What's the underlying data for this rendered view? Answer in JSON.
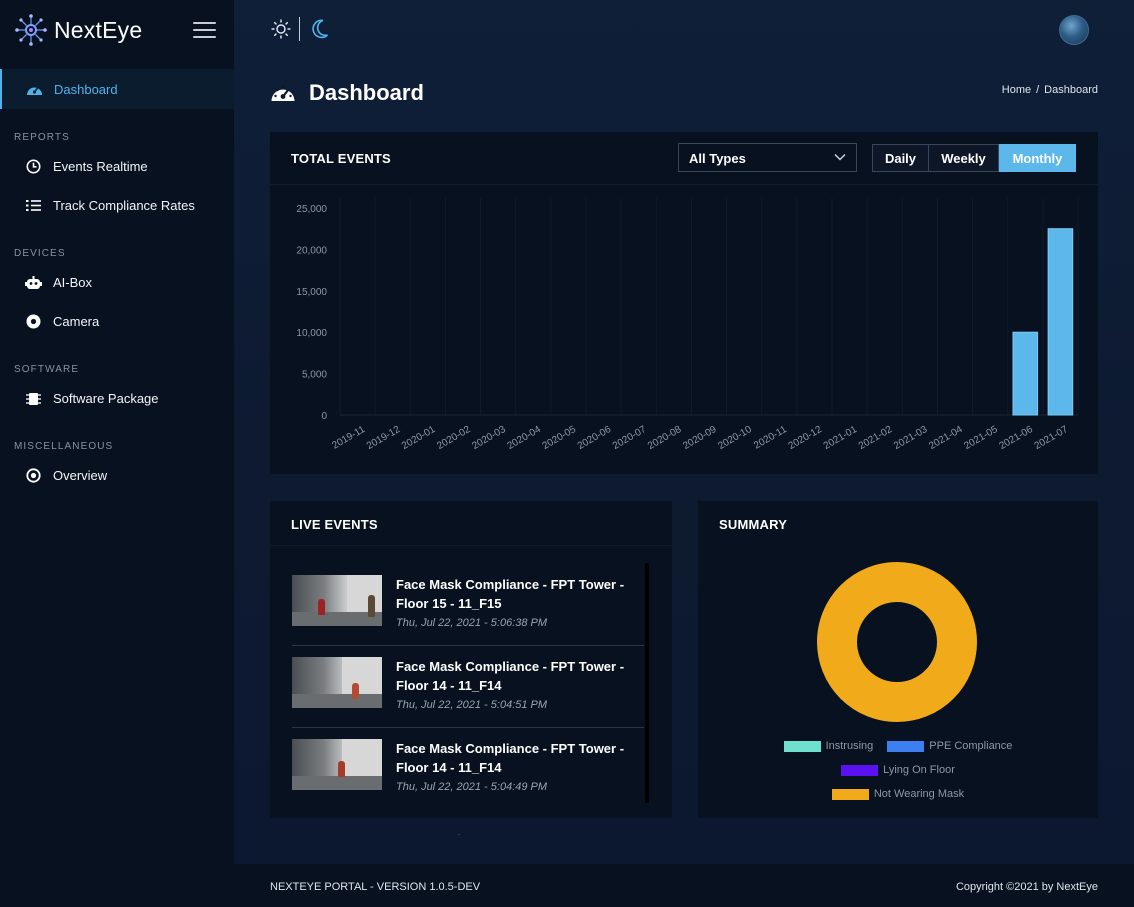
{
  "brand": {
    "name": "NextEye"
  },
  "sidebar": {
    "dashboard": "Dashboard",
    "sections": [
      {
        "title": "REPORTS",
        "items": [
          {
            "label": "Events Realtime",
            "icon": "clock-icon"
          },
          {
            "label": "Track Compliance Rates",
            "icon": "list-check-icon"
          }
        ]
      },
      {
        "title": "DEVICES",
        "items": [
          {
            "label": "AI-Box",
            "icon": "robot-icon"
          },
          {
            "label": "Camera",
            "icon": "camera-icon"
          }
        ]
      },
      {
        "title": "SOFTWARE",
        "items": [
          {
            "label": "Software Package",
            "icon": "chip-icon"
          }
        ]
      },
      {
        "title": "MISCELLANEOUS",
        "items": [
          {
            "label": "Overview",
            "icon": "target-icon"
          }
        ]
      }
    ]
  },
  "page": {
    "title": "Dashboard"
  },
  "breadcrumb": {
    "home": "Home",
    "sep": "/",
    "current": "Dashboard"
  },
  "total_events": {
    "title": "TOTAL EVENTS",
    "filter_value": "All Types",
    "periods": {
      "daily": "Daily",
      "weekly": "Weekly",
      "monthly": "Monthly"
    },
    "active_period": "Monthly"
  },
  "chart_data": {
    "type": "bar",
    "categories": [
      "2019-11",
      "2019-12",
      "2020-01",
      "2020-02",
      "2020-03",
      "2020-04",
      "2020-05",
      "2020-06",
      "2020-07",
      "2020-08",
      "2020-09",
      "2020-10",
      "2020-11",
      "2020-12",
      "2021-01",
      "2021-02",
      "2021-03",
      "2021-04",
      "2021-05",
      "2021-06",
      "2021-07"
    ],
    "values": [
      0,
      0,
      0,
      0,
      0,
      0,
      0,
      0,
      0,
      0,
      0,
      0,
      0,
      0,
      0,
      0,
      0,
      0,
      0,
      10000,
      22500
    ],
    "ylim": [
      0,
      25000
    ],
    "yticks": [
      "0",
      "5,000",
      "10,000",
      "15,000",
      "20,000",
      "25,000"
    ],
    "yticks_values": [
      0,
      5000,
      10000,
      15000,
      20000,
      25000
    ],
    "title": "",
    "xlabel": "",
    "ylabel": "",
    "bar_color": "#5cb8ea"
  },
  "live_events": {
    "title": "LIVE EVENTS",
    "items": [
      {
        "title": "Face Mask Compliance - FPT Tower - Floor 15 - 11_F15",
        "time": "Thu, Jul 22, 2021 - 5:06:38 PM"
      },
      {
        "title": "Face Mask Compliance - FPT Tower - Floor 14 - 11_F14",
        "time": "Thu, Jul 22, 2021 - 5:04:51 PM"
      },
      {
        "title": "Face Mask Compliance - FPT Tower - Floor 14 - 11_F14",
        "time": "Thu, Jul 22, 2021 - 5:04:49 PM"
      }
    ]
  },
  "summary": {
    "title": "SUMMARY",
    "legend": [
      {
        "label": "Instrusing",
        "color": "#6fe0d0"
      },
      {
        "label": "PPE Compliance",
        "color": "#3d7ff0"
      },
      {
        "label": "Lying On Floor",
        "color": "#5a12f0"
      },
      {
        "label": "Not Wearing Mask",
        "color": "#f0aa1a"
      }
    ],
    "donut_color": "#f0aa1a"
  },
  "footer": {
    "version": "NEXTEYE PORTAL - VERSION 1.0.5-DEV",
    "copyright": "Copyright ©2021 by NextEye"
  }
}
